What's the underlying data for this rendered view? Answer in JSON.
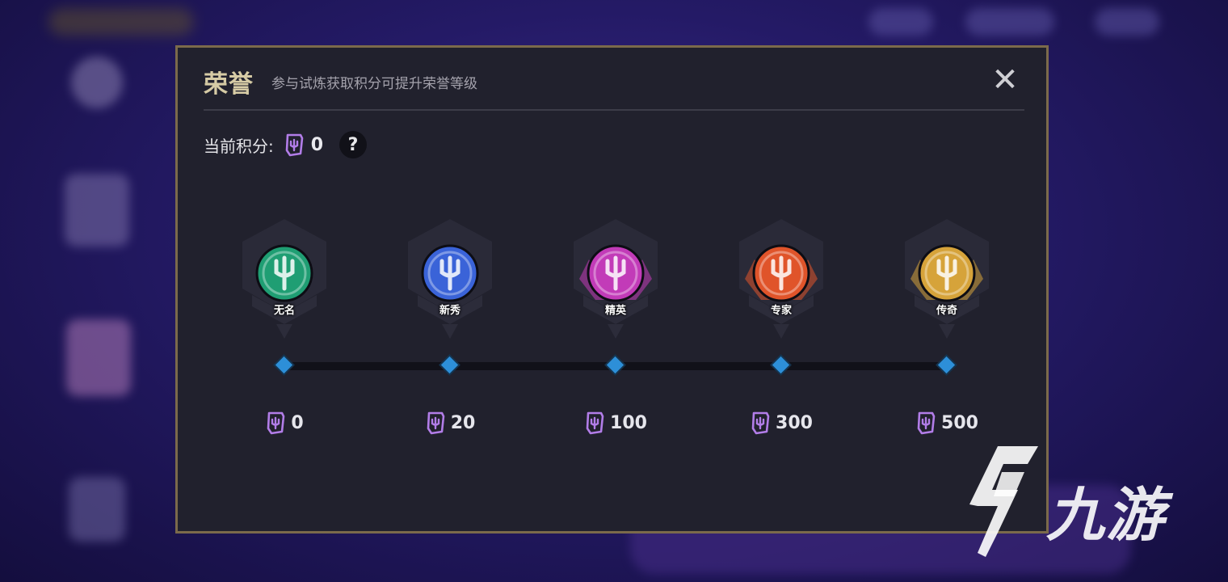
{
  "modal": {
    "title": "荣誉",
    "subtitle": "参与试炼获取积分可提升荣誉等级",
    "close_icon": "close-icon",
    "current_points_label": "当前积分:",
    "current_points_value": "0",
    "help_label": "?"
  },
  "tiers": [
    {
      "name": "无名",
      "cost": "0",
      "color": "#1f9e73"
    },
    {
      "name": "新秀",
      "cost": "20",
      "color": "#3a63d8"
    },
    {
      "name": "精英",
      "cost": "100",
      "color": "#c23bb8"
    },
    {
      "name": "专家",
      "cost": "300",
      "color": "#e0542a"
    },
    {
      "name": "传奇",
      "cost": "500",
      "color": "#d6a33a"
    }
  ],
  "colors": {
    "accent_border": "#7b6a4b",
    "node_blue": "#2d8fd8",
    "points_purple": "#b27de8"
  },
  "watermark": {
    "text": "九游"
  }
}
